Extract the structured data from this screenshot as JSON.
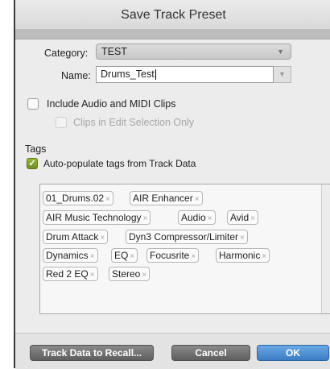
{
  "window": {
    "title": "Save Track Preset"
  },
  "form": {
    "category_label": "Category:",
    "category_value": "TEST",
    "name_label": "Name:",
    "name_value": "Drums_Test"
  },
  "options": {
    "include_clips_label": "Include Audio and MIDI Clips",
    "include_clips_checked": false,
    "edit_selection_label": "Clips in Edit Selection Only",
    "edit_selection_enabled": false
  },
  "tags": {
    "heading": "Tags",
    "autopopulate_label": "Auto-populate tags from Track Data",
    "autopopulate_checked": true,
    "items": [
      "01_Drums.02",
      "AIR Enhancer",
      "AIR Music Technology",
      "Audio",
      "Avid",
      "Drum Attack",
      "Dyn3 Compressor/Limiter",
      "Dynamics",
      "EQ",
      "Focusrite",
      "Harmonic",
      "Red 2 EQ",
      "Stereo"
    ]
  },
  "buttons": {
    "recall": "Track Data to Recall...",
    "cancel": "Cancel",
    "ok": "OK"
  },
  "icons": {
    "tag_remove": "×",
    "dropdown": "▼",
    "check": "✓"
  },
  "colors": {
    "ok_button": "#3a7cc4",
    "checked_box": "#7a9a26"
  }
}
